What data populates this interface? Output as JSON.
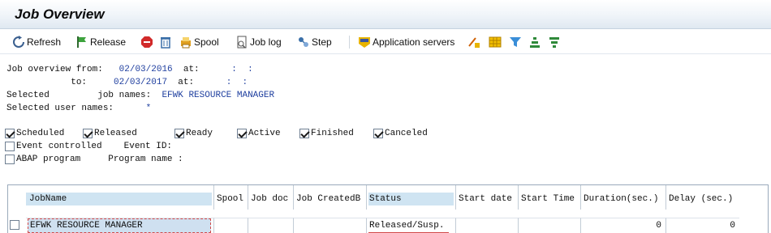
{
  "window": {
    "title": "Job Overview"
  },
  "toolbar": {
    "refresh": "Refresh",
    "release": "Release",
    "spool": "Spool",
    "job_log": "Job log",
    "step": "Step",
    "app_servers": "Application servers"
  },
  "criteria": {
    "from_label": "Job overview from:",
    "from_date": "02/03/2016",
    "at_label": "at:",
    "from_time": ":  :",
    "to_label": "to:",
    "to_date": "02/03/2017",
    "to_time": ":  :",
    "selected_label": "Selected",
    "job_names_label": "job names:",
    "job_names_value": "EFWK RESOURCE MANAGER",
    "user_names_label": "Selected user names:",
    "user_names_value": "*"
  },
  "status_filters": [
    {
      "label": "Scheduled",
      "checked": true
    },
    {
      "label": "Released",
      "checked": true
    },
    {
      "label": "Ready",
      "checked": true
    },
    {
      "label": "Active",
      "checked": true
    },
    {
      "label": "Finished",
      "checked": true
    },
    {
      "label": "Canceled",
      "checked": true
    }
  ],
  "event": {
    "label": "Event controlled",
    "id_label": "Event ID:",
    "checked": false
  },
  "abap": {
    "label": "ABAP program",
    "name_label": "Program name :",
    "checked": false
  },
  "table": {
    "columns": [
      "JobName",
      "Spool",
      "Job doc",
      "Job CreatedB",
      "Status",
      "Start date",
      "Start Time",
      "Duration(sec.)",
      "Delay (sec.)"
    ],
    "rows": [
      {
        "job_name": "EFWK RESOURCE MANAGER",
        "spool": "",
        "job_doc": "",
        "created_by": "",
        "status": "Released/Susp.",
        "start_date": "",
        "start_time": "",
        "duration": "0",
        "delay": "0"
      }
    ]
  }
}
